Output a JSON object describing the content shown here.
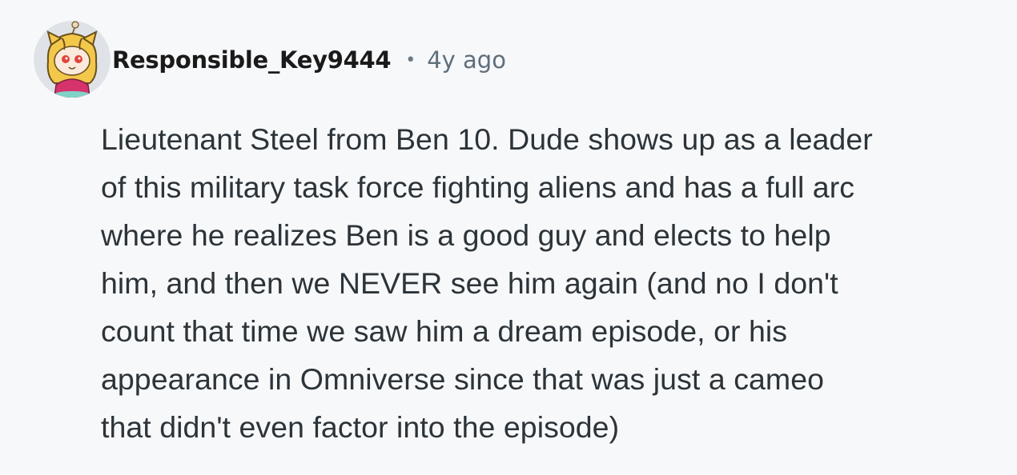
{
  "comment": {
    "author": "Responsible_Key9444",
    "separator": "•",
    "timestamp": "4y ago",
    "avatar_icon": "snoo-avatar-icon",
    "body_lines": [
      "Lieutenant Steel from Ben 10. Dude shows up as a leader",
      "of this military task force fighting aliens and has a full arc",
      "where he realizes Ben is a good guy and elects to help",
      "him, and then we NEVER see him again (and no I don't",
      "count that time we saw him a dream episode, or his",
      "appearance in Omniverse since that was just a cameo",
      "that didn't even factor into the episode)"
    ]
  },
  "colors": {
    "background": "#f7f8fa",
    "author": "#1a1a1b",
    "meta": "#5e6e7b",
    "body": "#2c3439"
  }
}
